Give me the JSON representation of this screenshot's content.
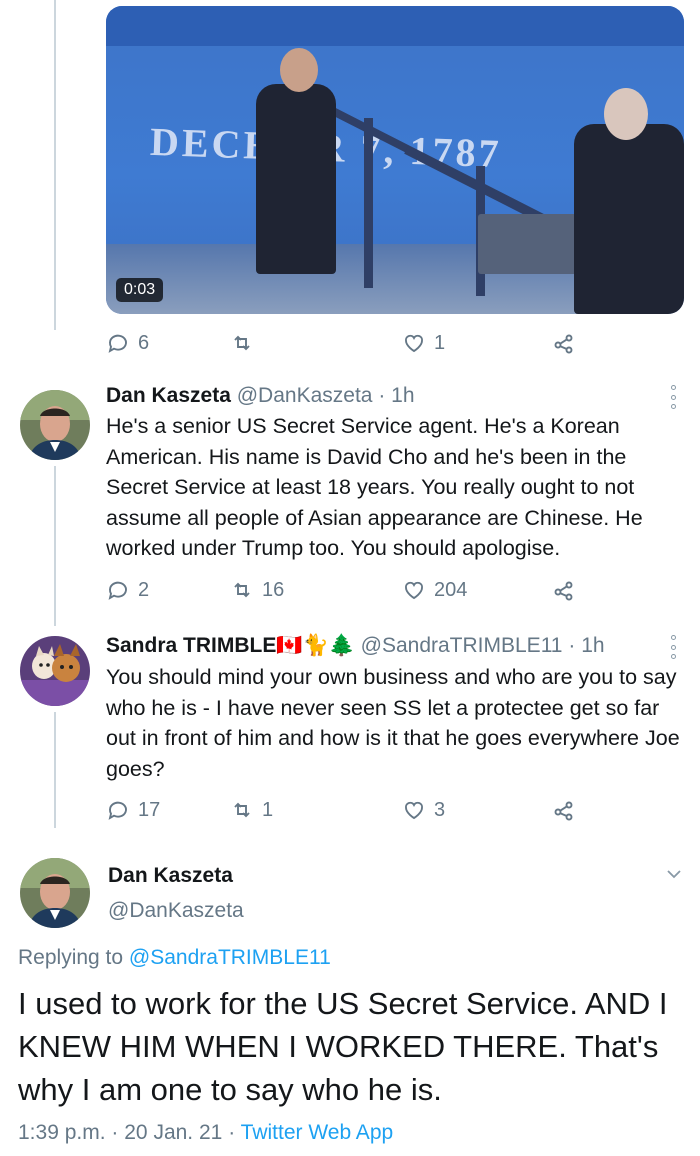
{
  "video": {
    "backdrop_text": "DECE  ER 7, 1787",
    "duration": "0:03"
  },
  "top_actions": {
    "replies": "6",
    "retweets": "",
    "likes": "1"
  },
  "tweets": [
    {
      "name": "Dan Kaszeta",
      "handle": "@DanKaszeta",
      "time": "1h",
      "text": "He's a senior US Secret Service agent. He's a Korean American. His name is David Cho and he's been in the Secret Service at least 18 years. You really ought to not assume all people of Asian appearance are Chinese. He worked under Trump too. You should apologise.",
      "replies": "2",
      "retweets": "16",
      "likes": "204"
    },
    {
      "name": "Sandra TRIMBLE🇨🇦🐈🌲",
      "handle": "@SandraTRIMBLE11",
      "time": "1h",
      "text": "You should mind your own business and who are you to say who he is - I have never seen SS let a protectee get so far out in front of him and how is it that he goes everywhere Joe goes?",
      "replies": "17",
      "retweets": "1",
      "likes": "3"
    }
  ],
  "focus_tweet": {
    "name": "Dan Kaszeta",
    "handle": "@DanKaszeta",
    "replying_prefix": "Replying to",
    "replying_to": "@SandraTRIMBLE11",
    "text": "I used to work for the US Secret Service. AND I KNEW HIM WHEN I WORKED THERE. That's why I am one to say who he is.",
    "time": "1:39 p.m.",
    "date": "20 Jan. 21",
    "client": "Twitter Web App"
  },
  "colors": {
    "link": "#1da1f2",
    "muted": "#657786",
    "text": "#14171a",
    "thread_line": "#ccd6dd"
  },
  "icons": [
    "reply-icon",
    "retweet-icon",
    "like-icon",
    "share-icon",
    "more-icon",
    "chevron-down-icon"
  ]
}
